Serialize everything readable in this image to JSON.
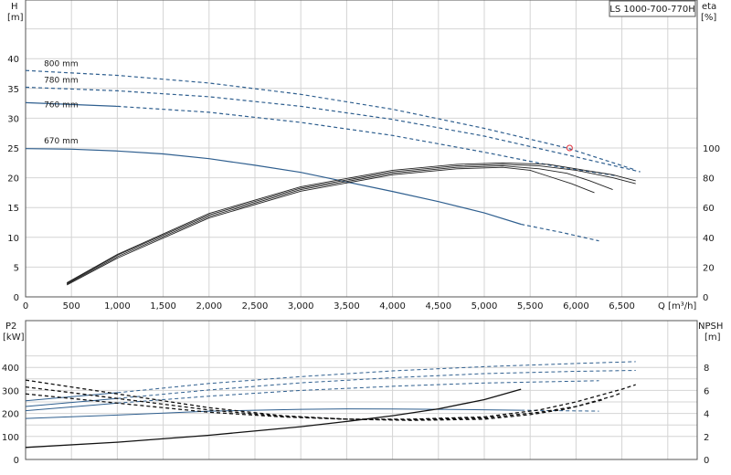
{
  "title": "LS 1000-700-770H",
  "chart_data": [
    {
      "type": "line",
      "panel": "head-efficiency",
      "xlabel": "Q [m³/h]",
      "x_ticks": [
        "0",
        "500",
        "1,000",
        "1,500",
        "2,000",
        "2,500",
        "3,000",
        "3,500",
        "4,000",
        "4,500",
        "5,000",
        "5,500",
        "6,000",
        "6,500"
      ],
      "xlim": [
        0,
        7400
      ],
      "ylabel_left": [
        "H",
        "[m]"
      ],
      "ylim_left": [
        0,
        45
      ],
      "yticks_left": [
        "0",
        "5",
        "10",
        "15",
        "20",
        "25",
        "30",
        "35",
        "40"
      ],
      "ylabel_right": [
        "eta",
        "[%]"
      ],
      "ylim_right": [
        0,
        100
      ],
      "yticks_right": [
        "0",
        "20",
        "40",
        "60",
        "80",
        "100"
      ],
      "yticks_right_values": [
        0,
        20,
        40,
        60,
        80,
        100
      ],
      "grid": true,
      "head_series": [
        {
          "name": "800 mm",
          "x": [
            0,
            1000,
            2000,
            3000,
            4000,
            5000,
            5900,
            6650
          ],
          "y": [
            38,
            37.2,
            35.9,
            34,
            31.5,
            28.3,
            25,
            21.3
          ],
          "dash_from": 0,
          "label_at": [
            200,
            38.3
          ]
        },
        {
          "name": "780 mm",
          "x": [
            0,
            1000,
            2000,
            3000,
            4000,
            5000,
            6000,
            6700
          ],
          "y": [
            35.2,
            34.6,
            33.6,
            32,
            29.8,
            27,
            23.5,
            21
          ],
          "dash_from": 0,
          "label_at": [
            200,
            35.5
          ]
        },
        {
          "name": "760 mm",
          "x": [
            0,
            1000,
            2000,
            3000,
            4000,
            5000,
            5750,
            6450
          ],
          "y": [
            32.6,
            32,
            31,
            29.3,
            27.1,
            24.3,
            22,
            20.3
          ],
          "dash_from": 1000,
          "label_at": [
            200,
            31.4
          ]
        },
        {
          "name": "670 mm",
          "x": [
            0,
            500,
            1000,
            1500,
            2000,
            2500,
            3000,
            3500,
            4000,
            4500,
            5000,
            5400,
            5850,
            6250
          ],
          "y": [
            24.9,
            24.8,
            24.5,
            24,
            23.2,
            22.1,
            20.9,
            19.3,
            17.7,
            16,
            14.1,
            12.2,
            10.8,
            9.4
          ],
          "solid_to": 5400,
          "label_at": [
            200,
            25.3
          ]
        }
      ],
      "efficiency_series": [
        {
          "x": [
            450,
            1000,
            2000,
            3000,
            4000,
            4700,
            5200,
            5500,
            5700,
            5950,
            6200
          ],
          "y": [
            8,
            26,
            53,
            71,
            82,
            86,
            87,
            85,
            81,
            76,
            70
          ]
        },
        {
          "x": [
            450,
            1000,
            2000,
            3000,
            4000,
            4700,
            5200,
            5600,
            5900,
            6150,
            6400
          ],
          "y": [
            8.5,
            27,
            54,
            72,
            83,
            87,
            88,
            86,
            83,
            78,
            72
          ]
        },
        {
          "x": [
            450,
            1000,
            2000,
            3000,
            4000,
            4700,
            5200,
            5600,
            6000,
            6400,
            6650
          ],
          "y": [
            9,
            28,
            55,
            73,
            84,
            88,
            89,
            88,
            85,
            80,
            76
          ]
        },
        {
          "x": [
            450,
            1000,
            2000,
            3000,
            4000,
            4700,
            5200,
            5700,
            6000,
            6400,
            6650
          ],
          "y": [
            9.5,
            28.5,
            56,
            74,
            85,
            89,
            90,
            89,
            86,
            82,
            78
          ]
        }
      ],
      "duty_point": {
        "x": 5930,
        "y": 25
      }
    },
    {
      "type": "line",
      "panel": "power-npsh",
      "xlim": [
        0,
        7400
      ],
      "ylabel_left": [
        "P2",
        "[kW]"
      ],
      "ylim_left": [
        0,
        480
      ],
      "yticks_left": [
        "0",
        "100",
        "200",
        "300",
        "400"
      ],
      "yticks_left_values": [
        0,
        100,
        200,
        300,
        400
      ],
      "ylabel_right": [
        "NPSH",
        "[m]"
      ],
      "ylim_right": [
        0,
        9.6
      ],
      "yticks_right": [
        "0",
        "2",
        "4",
        "6",
        "8"
      ],
      "yticks_right_values": [
        0,
        2,
        4,
        6,
        8
      ],
      "grid": true,
      "power_series": [
        {
          "x": [
            0,
            1000,
            2000,
            3000,
            4000,
            5000,
            6000,
            6650
          ],
          "y": [
            255,
            290,
            330,
            360,
            385,
            403,
            417,
            425
          ],
          "dash_from": 1000
        },
        {
          "x": [
            0,
            1000,
            2000,
            3000,
            4000,
            5000,
            6000,
            6650
          ],
          "y": [
            230,
            265,
            302,
            333,
            355,
            373,
            383,
            387
          ],
          "dash_from": 1000
        },
        {
          "x": [
            0,
            1000,
            2000,
            3000,
            4000,
            5000,
            6000,
            6250
          ],
          "y": [
            212,
            245,
            275,
            300,
            318,
            332,
            340,
            342
          ],
          "dash_from": 1000
        },
        {
          "x": [
            0,
            1000,
            2000,
            3000,
            3500,
            4000,
            4500,
            5000,
            5400,
            5800,
            6250
          ],
          "y": [
            178,
            193,
            210,
            218,
            220,
            219,
            218,
            216,
            214,
            212,
            210
          ],
          "solid_to": 5400
        }
      ],
      "npsh_series": [
        {
          "x": [
            0,
            1000,
            2000,
            3000,
            3500,
            4000,
            4500,
            5000,
            5400
          ],
          "y": [
            1.05,
            1.5,
            2.1,
            2.85,
            3.3,
            3.8,
            4.4,
            5.2,
            6.1
          ],
          "solid_to": 5400
        },
        {
          "x": [
            0,
            1000,
            2000,
            2800,
            3500,
            4200,
            5000,
            5600,
            6000,
            6500,
            6650
          ],
          "y": [
            6.9,
            5.7,
            4.5,
            3.8,
            3.5,
            3.5,
            3.7,
            4.3,
            5.0,
            6.1,
            6.5
          ],
          "dash_from": 0
        },
        {
          "x": [
            0,
            1000,
            2000,
            2800,
            3500,
            4200,
            5000,
            5600,
            6000,
            6400,
            6500
          ],
          "y": [
            6.3,
            5.3,
            4.3,
            3.75,
            3.5,
            3.45,
            3.6,
            4.1,
            4.6,
            5.5,
            5.8
          ],
          "dash_from": 0
        },
        {
          "x": [
            0,
            1000,
            2000,
            2800,
            3500,
            4200,
            5000,
            5500,
            5900,
            6200,
            6300
          ],
          "y": [
            5.7,
            4.9,
            4.1,
            3.7,
            3.5,
            3.4,
            3.5,
            3.9,
            4.4,
            5.0,
            5.2
          ],
          "dash_from": 0
        }
      ]
    }
  ]
}
